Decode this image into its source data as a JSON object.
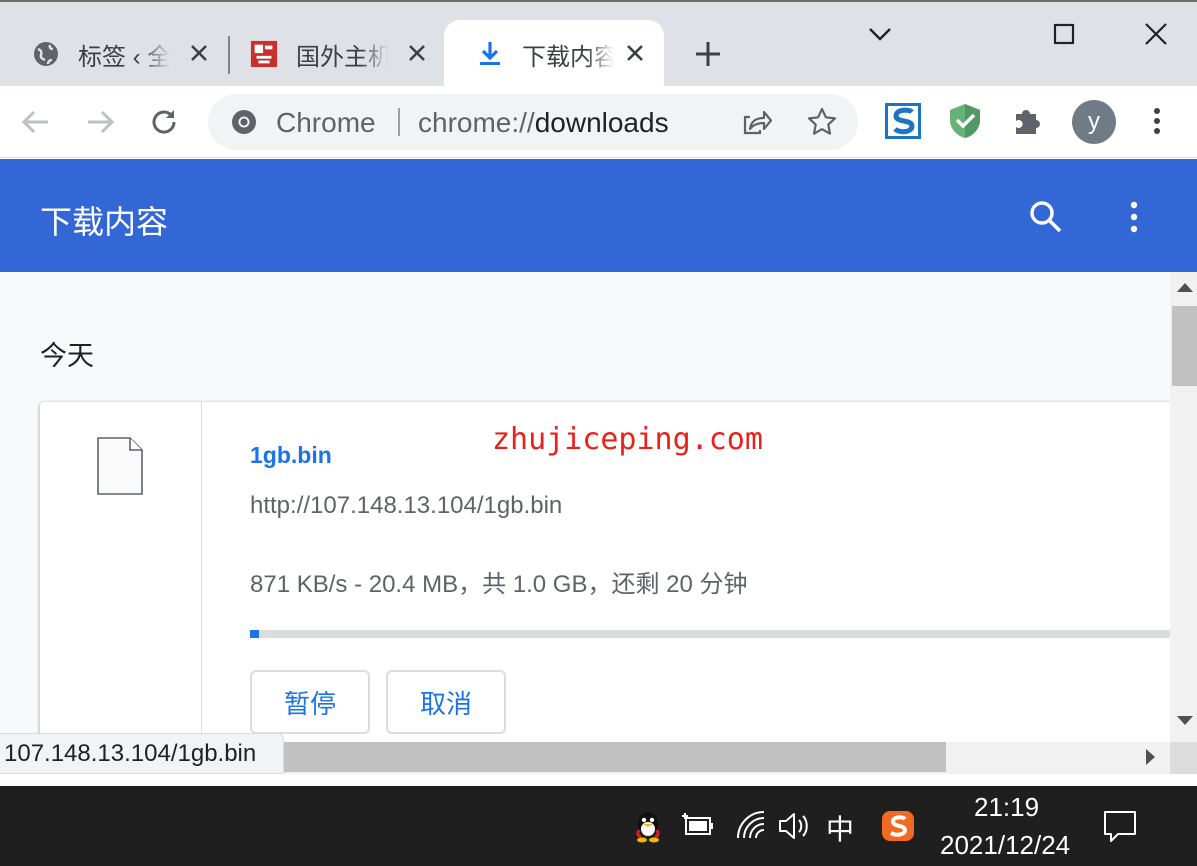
{
  "tabs": [
    {
      "title": "标签 ‹ 全",
      "icon": "globe-icon"
    },
    {
      "title": "国外主机",
      "icon": "site-favicon"
    },
    {
      "title": "下载内容",
      "icon": "download-icon"
    }
  ],
  "toolbar": {
    "omnibox_chip": "Chrome",
    "url_scheme": "chrome://",
    "url_path": "downloads",
    "avatar_letter": "y"
  },
  "page": {
    "title": "下载内容",
    "date_group": "今天"
  },
  "download": {
    "filename": "1gb.bin",
    "url": "http://107.148.13.104/1gb.bin",
    "status": "871 KB/s - 20.4 MB，共 1.0 GB，还剩 20 分钟",
    "progress_fraction": 0.0102,
    "pause_label": "暂停",
    "cancel_label": "取消"
  },
  "watermark": "zhujiceping.com",
  "status_bubble": "107.148.13.104/1gb.bin",
  "taskbar": {
    "ime": "中",
    "time": "21:19",
    "date": "2021/12/24"
  },
  "colors": {
    "accent": "#3367d6",
    "link": "#1a73e8",
    "watermark": "#e8221b"
  }
}
